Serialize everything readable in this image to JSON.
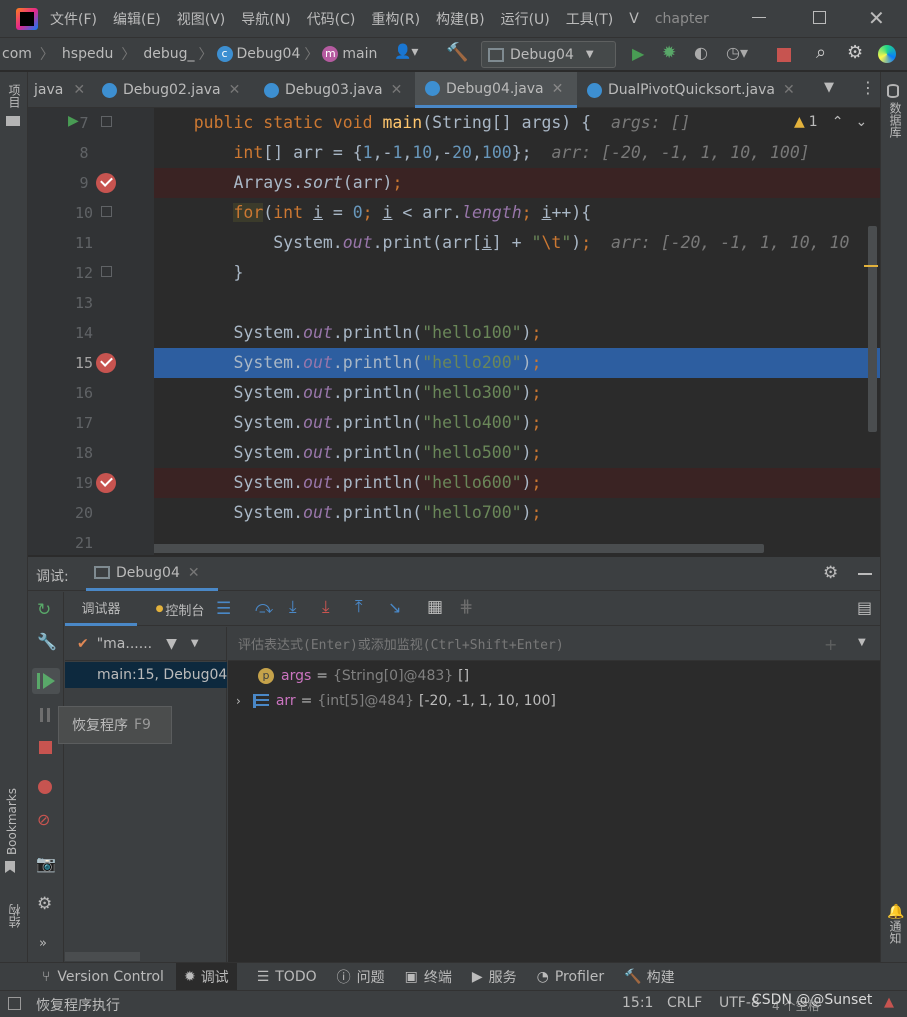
{
  "menu": [
    "文件(F)",
    "编辑(E)",
    "视图(V)",
    "导航(N)",
    "代码(C)",
    "重构(R)",
    "构建(B)",
    "运行(U)",
    "工具(T)",
    "V",
    "chapter"
  ],
  "nav": {
    "crumbs": [
      "com",
      "hspedu",
      "debug_",
      "Debug04",
      "main"
    ],
    "run_config": "Debug04"
  },
  "tabs": [
    {
      "label": "java"
    },
    {
      "label": "Debug02.java"
    },
    {
      "label": "Debug03.java"
    },
    {
      "label": "Debug04.java"
    },
    {
      "label": "DualPivotQuicksort.java"
    }
  ],
  "left_tool": {
    "project": "项目",
    "bookmarks": "Bookmarks",
    "structure": "结构"
  },
  "right_tool": {
    "database": "数据库",
    "notifications": "通知"
  },
  "editor": {
    "warning_count": "1",
    "line_numbers": [
      "7",
      "8",
      "9",
      "10",
      "11",
      "12",
      "13",
      "14",
      "15",
      "16",
      "17",
      "18",
      "19",
      "20",
      "21"
    ],
    "hint_args": "args: []",
    "hint_arr": "arr: [-20, -1, 1, 10, 100]",
    "hint_arr_cut": "arr: [-20, -1, 1, 10, 10"
  },
  "debug": {
    "label": "调试:",
    "session": "Debug04",
    "tab_debugger": "调试器",
    "tab_console": "控制台",
    "thread": "\"ma......",
    "frame": "main:15, Debug04",
    "eval_placeholder": "评估表达式(Enter)或添加监视(Ctrl+Shift+Enter)",
    "vars": [
      {
        "name": "args",
        "ref": "{String[0]@483}",
        "value": "[]"
      },
      {
        "name": "arr",
        "ref": "{int[5]@484}",
        "value": "[-20, -1, 1, 10, 100]"
      }
    ],
    "tooltip": "恢复程序",
    "tooltip_key": "F9"
  },
  "bottom_tools": [
    "Version Control",
    "调试",
    "TODO",
    "问题",
    "终端",
    "服务",
    "Profiler",
    "构建"
  ],
  "status": {
    "message": "恢复程序执行",
    "position": "15:1",
    "line_sep": "CRLF",
    "encoding": "UTF-8",
    "watermark": "CSDN @@Sunset",
    "spaces": "4 个空格"
  }
}
